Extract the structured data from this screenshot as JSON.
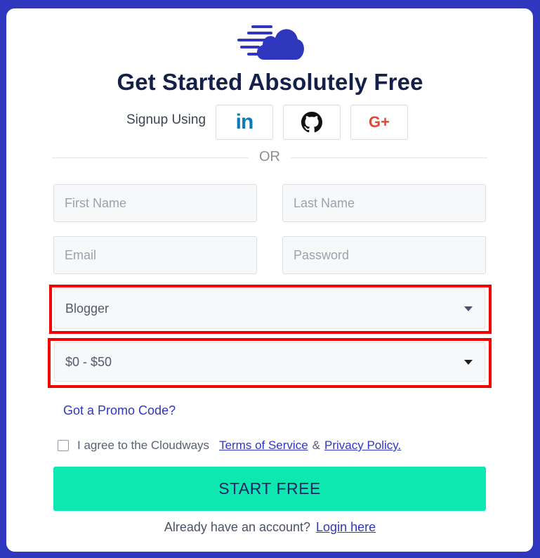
{
  "page": {
    "brand_color": "#2f37be",
    "accent_color": "#0ce8b0",
    "title": "Get Started Absolutely Free"
  },
  "social": {
    "label": "Signup Using",
    "buttons": [
      {
        "name": "linkedin",
        "icon": "linkedin-icon",
        "glyph": "in"
      },
      {
        "name": "github",
        "icon": "github-icon",
        "glyph": ""
      },
      {
        "name": "google-plus",
        "icon": "google-plus-icon",
        "glyph": "G+"
      }
    ]
  },
  "divider": {
    "text": "OR"
  },
  "form": {
    "first_name": {
      "placeholder": "First Name",
      "value": ""
    },
    "last_name": {
      "placeholder": "Last Name",
      "value": ""
    },
    "email": {
      "placeholder": "Email",
      "value": ""
    },
    "password": {
      "placeholder": "Password",
      "value": ""
    },
    "role_select": {
      "selected": "Blogger"
    },
    "budget_select": {
      "selected": "$0 - $50"
    },
    "promo_link": "Got a Promo Code?",
    "agree": {
      "checked": false,
      "text": "I agree to the Cloudways",
      "terms_link": "Terms of Service",
      "ampersand": "&",
      "privacy_link": "Privacy Policy."
    },
    "submit_label": "START FREE"
  },
  "footer": {
    "prompt": "Already have an account?",
    "login_link": "Login here"
  }
}
